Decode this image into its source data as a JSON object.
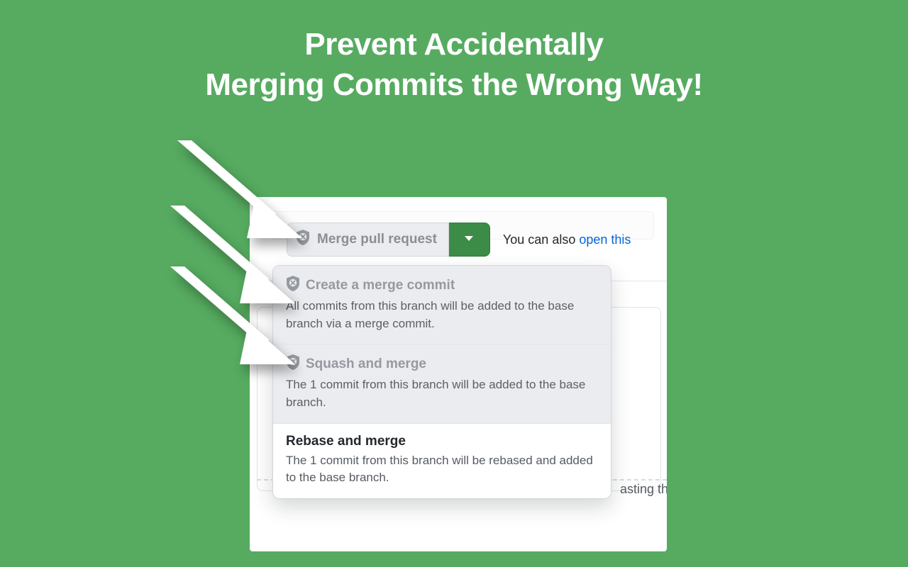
{
  "headline": {
    "line1": "Prevent Accidentally",
    "line2": "Merging Commits the Wrong Way!"
  },
  "merge_button": {
    "label": "Merge pull request"
  },
  "hint": {
    "prefix": "You can also ",
    "link": "open this"
  },
  "options": [
    {
      "title": "Create a merge commit",
      "desc": "All commits from this branch will be added to the base branch via a merge commit.",
      "enabled": false,
      "has_shield": true
    },
    {
      "title": "Squash and merge",
      "desc": "The 1 commit from this branch will be added to the base branch.",
      "enabled": false,
      "has_shield": true
    },
    {
      "title": "Rebase and merge",
      "desc": "The 1 commit from this branch will be rebased and added to the base branch.",
      "enabled": true,
      "has_shield": false
    }
  ],
  "trail_text": "asting th"
}
